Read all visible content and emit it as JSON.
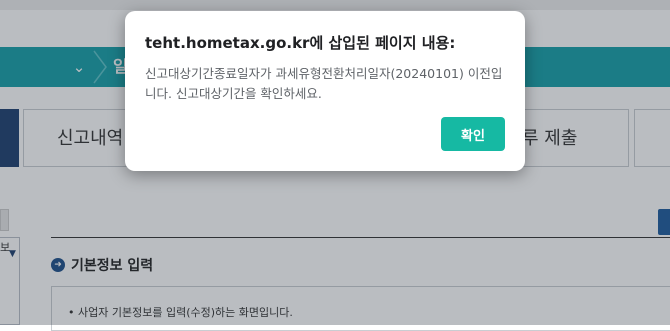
{
  "background_page": {
    "nav": {
      "label": "일"
    },
    "tabs": [
      {
        "label": "신고내역"
      },
      {
        "label": "루 제출"
      }
    ],
    "left_panel": {
      "label": "보"
    },
    "section": {
      "title": "기본정보 입력",
      "info_text": "사업자 기본정보를 입력(수정)하는 화면입니다."
    }
  },
  "dialog": {
    "title": "teht.hometax.go.kr에 삽입된 페이지 내용:",
    "message": "신고대상기간종료일자가 과세유형전환처리일자(20240101) 이전입니다. 신고대상기간을 확인하세요.",
    "ok_label": "확인"
  },
  "colors": {
    "nav_bar": "#159fa8",
    "dialog_button": "#16b9a3",
    "dark_tab": "#1c3f6f"
  }
}
